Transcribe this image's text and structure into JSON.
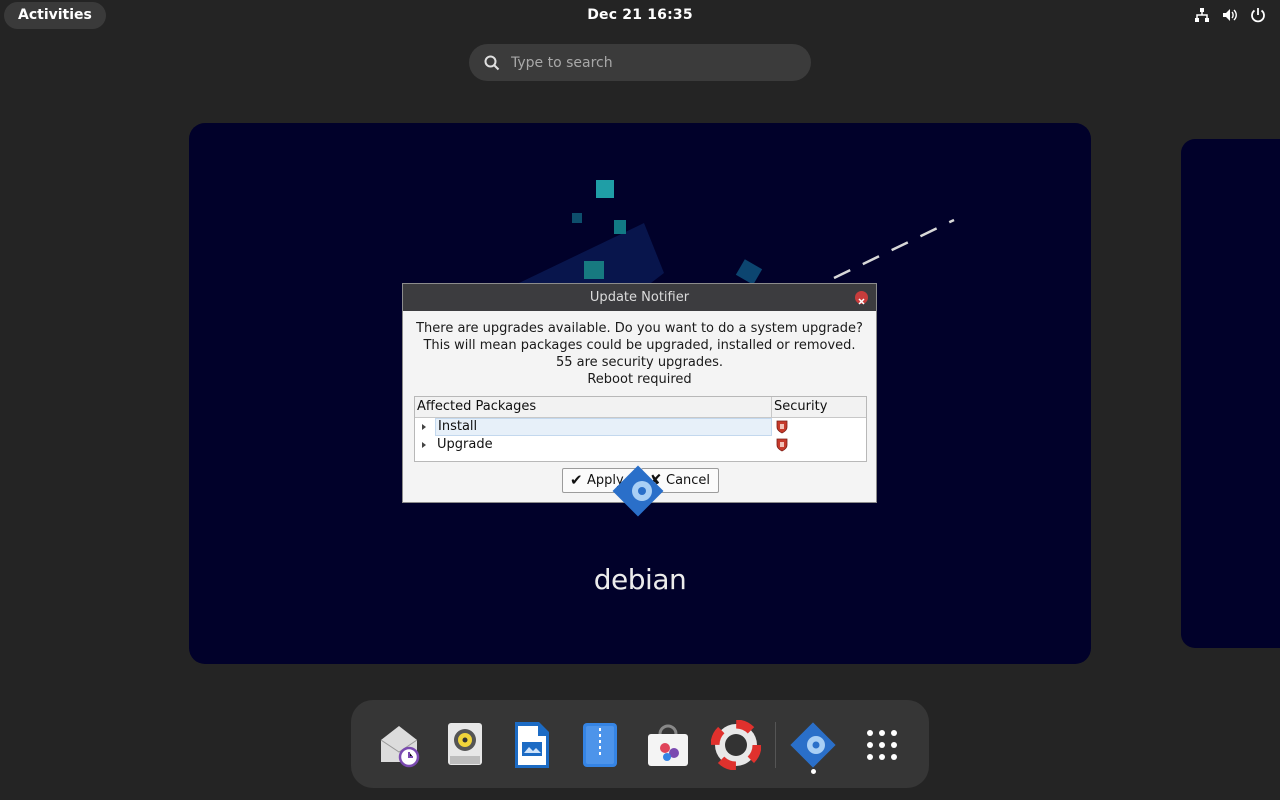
{
  "topbar": {
    "activities_label": "Activities",
    "clock": "Dec 21  16:35",
    "tray_icons": [
      "network-icon",
      "volume-icon",
      "power-icon"
    ]
  },
  "search": {
    "placeholder": "Type to search"
  },
  "workspace": {
    "wallpaper_text": "debian"
  },
  "dialog": {
    "title": "Update Notifier",
    "message_lines": [
      "There are upgrades available. Do you want to do a system upgrade?",
      "This will mean packages could be upgraded, installed or removed.",
      "55 are security upgrades.",
      "Reboot required"
    ],
    "columns": [
      "Affected Packages",
      "Security"
    ],
    "rows": [
      {
        "label": "Install",
        "selected": true
      },
      {
        "label": "Upgrade",
        "selected": false
      }
    ],
    "apply_label": "Apply",
    "cancel_label": "Cancel"
  },
  "dash": {
    "items": [
      "evolution-icon",
      "rhythmbox-icon",
      "writer-icon",
      "file-roller-icon",
      "software-icon",
      "help-icon",
      "update-notifier-icon",
      "app-grid-icon"
    ]
  },
  "colors": {
    "wallpaper": "#01012a",
    "panel": "#242424",
    "accent": "#3584e4"
  }
}
